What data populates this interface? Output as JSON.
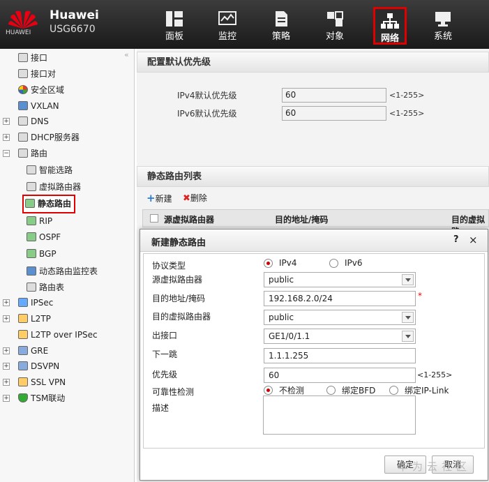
{
  "header": {
    "brand": "HUAWEI",
    "product_line1": "Huawei",
    "product_line2": "USG6670",
    "nav": [
      {
        "label": "面板",
        "icon": "dashboard-icon"
      },
      {
        "label": "监控",
        "icon": "monitor-icon"
      },
      {
        "label": "策略",
        "icon": "policy-icon"
      },
      {
        "label": "对象",
        "icon": "object-icon"
      },
      {
        "label": "网络",
        "icon": "network-icon",
        "active": true
      },
      {
        "label": "系统",
        "icon": "system-icon"
      }
    ]
  },
  "sidebar": {
    "collapse": "«",
    "items": [
      {
        "label": "接口"
      },
      {
        "label": "接口对"
      },
      {
        "label": "安全区域"
      },
      {
        "label": "VXLAN"
      },
      {
        "label": "DNS",
        "expander": "+"
      },
      {
        "label": "DHCP服务器",
        "expander": "+"
      },
      {
        "label": "路由",
        "expander": "−"
      },
      {
        "label": "智能选路"
      },
      {
        "label": "虚拟路由器"
      },
      {
        "label": "静态路由",
        "selected": true
      },
      {
        "label": "RIP"
      },
      {
        "label": "OSPF"
      },
      {
        "label": "BGP"
      },
      {
        "label": "动态路由监控表"
      },
      {
        "label": "路由表"
      },
      {
        "label": "IPSec",
        "expander": "+"
      },
      {
        "label": "L2TP",
        "expander": "+"
      },
      {
        "label": "L2TP over IPSec"
      },
      {
        "label": "GRE",
        "expander": "+"
      },
      {
        "label": "DSVPN",
        "expander": "+"
      },
      {
        "label": "SSL VPN",
        "expander": "+"
      },
      {
        "label": "TSM联动",
        "expander": "+"
      }
    ]
  },
  "priority": {
    "title": "配置默认优先级",
    "ipv4_label": "IPv4默认优先级",
    "ipv4_value": "60",
    "ipv4_hint": "<1-255>",
    "ipv6_label": "IPv6默认优先级",
    "ipv6_value": "60",
    "ipv6_hint": "<1-255>"
  },
  "route_list": {
    "title": "静态路由列表",
    "new_label": "新建",
    "delete_label": "删除",
    "columns": [
      "源虚拟路由器",
      "目的地址/掩码",
      "目的虚拟路"
    ]
  },
  "dialog": {
    "title": "新建静态路由",
    "help": "?",
    "close": "×",
    "protocol_label": "协议类型",
    "ipv4_option": "IPv4",
    "ipv6_option": "IPv6",
    "src_vr_label": "源虚拟路由器",
    "src_vr_value": "public",
    "dest_label": "目的地址/掩码",
    "dest_value": "192.168.2.0/24",
    "required_mark": "*",
    "dst_vr_label": "目的虚拟路由器",
    "dst_vr_value": "public",
    "out_if_label": "出接口",
    "out_if_value": "GE1/0/1.1",
    "next_hop_label": "下一跳",
    "next_hop_value": "1.1.1.255",
    "priority_label": "优先级",
    "priority_value": "60",
    "priority_hint": "<1-255>",
    "reliability_label": "可靠性检测",
    "opt_none": "不检测",
    "opt_bfd": "绑定BFD",
    "opt_iplink": "绑定IP-Link",
    "desc_label": "描述",
    "ok_label": "确定",
    "cancel_label": "取消"
  },
  "watermark": "华为云社区",
  "colors": {
    "accent": "#e00000",
    "header_bg": "#2a2a2a"
  }
}
